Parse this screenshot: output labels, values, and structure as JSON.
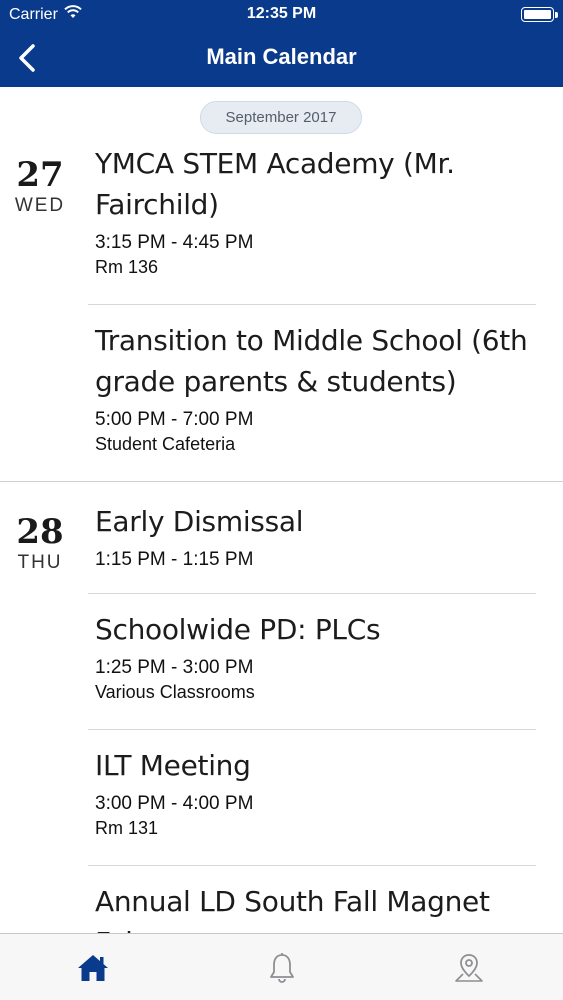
{
  "status_bar": {
    "carrier": "Carrier",
    "time": "12:35 PM"
  },
  "nav": {
    "title": "Main Calendar"
  },
  "month_label": "September 2017",
  "days": [
    {
      "number": "27",
      "weekday": "WED",
      "events": [
        {
          "title": "YMCA STEM Academy (Mr. Fairchild)",
          "time": "3:15 PM - 4:45 PM",
          "location": "Rm 136"
        },
        {
          "title": "Transition to Middle School (6th grade parents & students)",
          "time": "5:00 PM - 7:00 PM",
          "location": "Student Cafeteria"
        }
      ]
    },
    {
      "number": "28",
      "weekday": "THU",
      "events": [
        {
          "title": "Early Dismissal",
          "time": "1:15 PM - 1:15 PM",
          "location": ""
        },
        {
          "title": "Schoolwide PD: PLCs",
          "time": "1:25 PM - 3:00 PM",
          "location": "Various Classrooms"
        },
        {
          "title": "ILT Meeting",
          "time": "3:00 PM - 4:00 PM",
          "location": "Rm 131"
        },
        {
          "title": "Annual LD South Fall Magnet Fair",
          "time": "",
          "location": ""
        }
      ]
    }
  ],
  "tabs": [
    {
      "icon": "home-icon",
      "active": true
    },
    {
      "icon": "bell-icon",
      "active": false
    },
    {
      "icon": "map-pin-icon",
      "active": false
    }
  ],
  "colors": {
    "header": "#0a3a8c",
    "active_tab": "#0a3a8c",
    "inactive_tab": "#8e8e93"
  }
}
